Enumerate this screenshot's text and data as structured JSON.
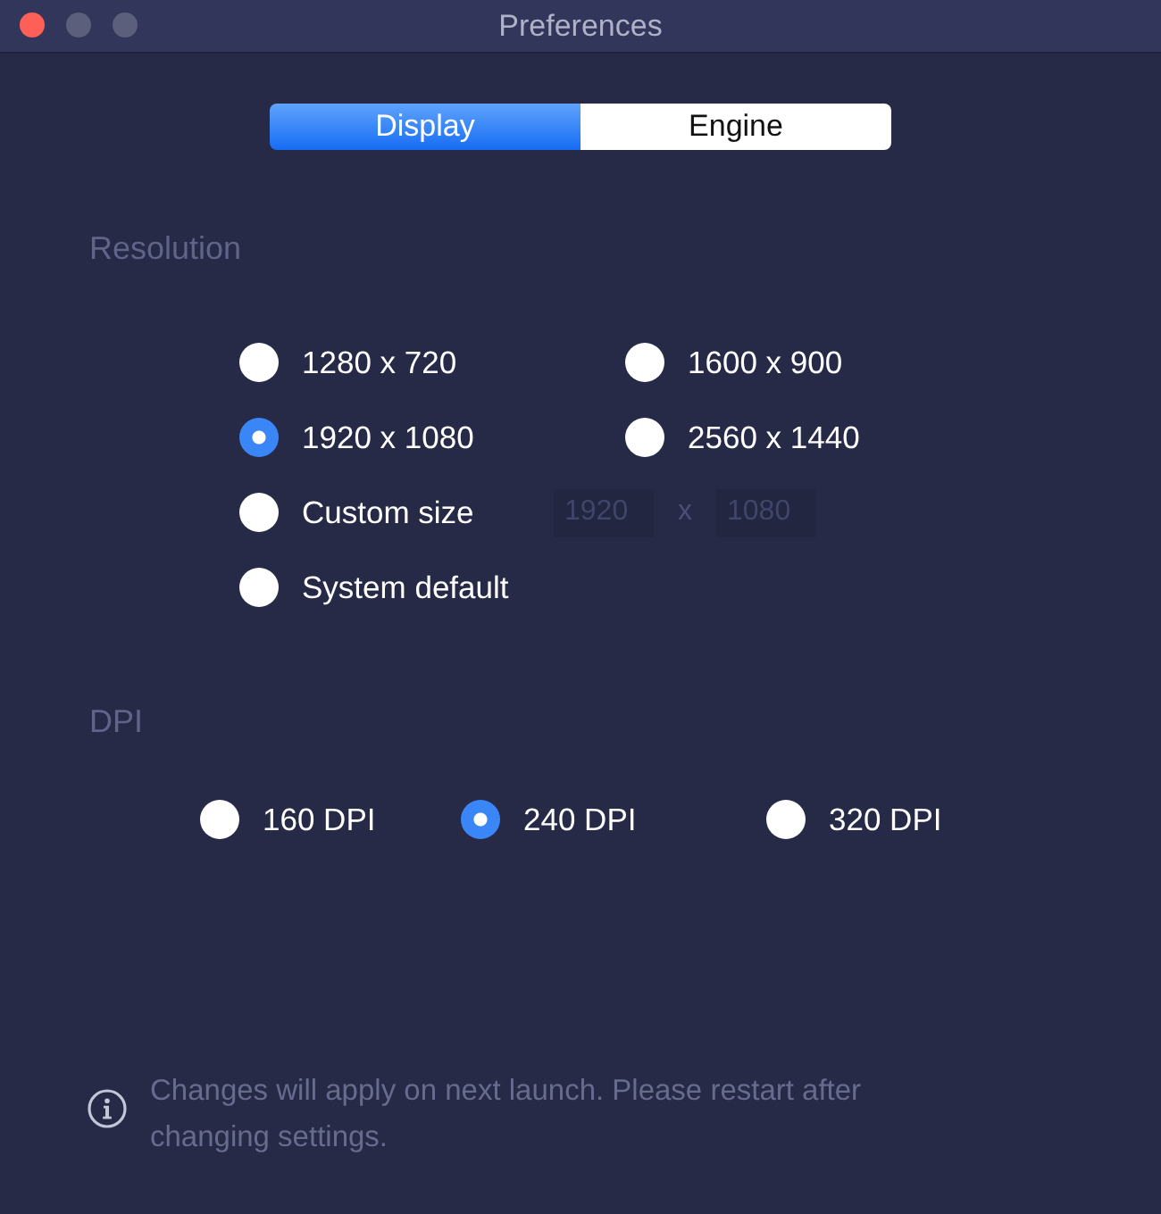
{
  "window": {
    "title": "Preferences",
    "controls": [
      {
        "kind": "close",
        "disabled": false
      },
      {
        "kind": "minimize",
        "disabled": true
      },
      {
        "kind": "zoom",
        "disabled": true
      }
    ]
  },
  "tabs": [
    {
      "label": "Display",
      "selected": true
    },
    {
      "label": "Engine",
      "selected": false
    }
  ],
  "resolution": {
    "heading": "Resolution",
    "options": [
      {
        "kind": "preset",
        "label": "1280 x 720",
        "selected": false
      },
      {
        "kind": "preset",
        "label": "1600 x 900",
        "selected": false
      },
      {
        "kind": "preset",
        "label": "1920 x 1080",
        "selected": true
      },
      {
        "kind": "preset",
        "label": "2560 x 1440",
        "selected": false
      },
      {
        "kind": "custom",
        "label": "Custom size",
        "selected": false,
        "width": {
          "value": "1920",
          "disabled": true
        },
        "separator": "x",
        "height": {
          "value": "1080",
          "disabled": true
        }
      },
      {
        "kind": "preset",
        "label": "System default",
        "selected": false
      }
    ]
  },
  "dpi": {
    "heading": "DPI",
    "options": [
      {
        "label": "160 DPI",
        "selected": false
      },
      {
        "label": "240 DPI",
        "selected": true
      },
      {
        "label": "320 DPI",
        "selected": false
      }
    ]
  },
  "notice": {
    "text": "Changes will apply on next launch. Please restart after changing settings."
  }
}
